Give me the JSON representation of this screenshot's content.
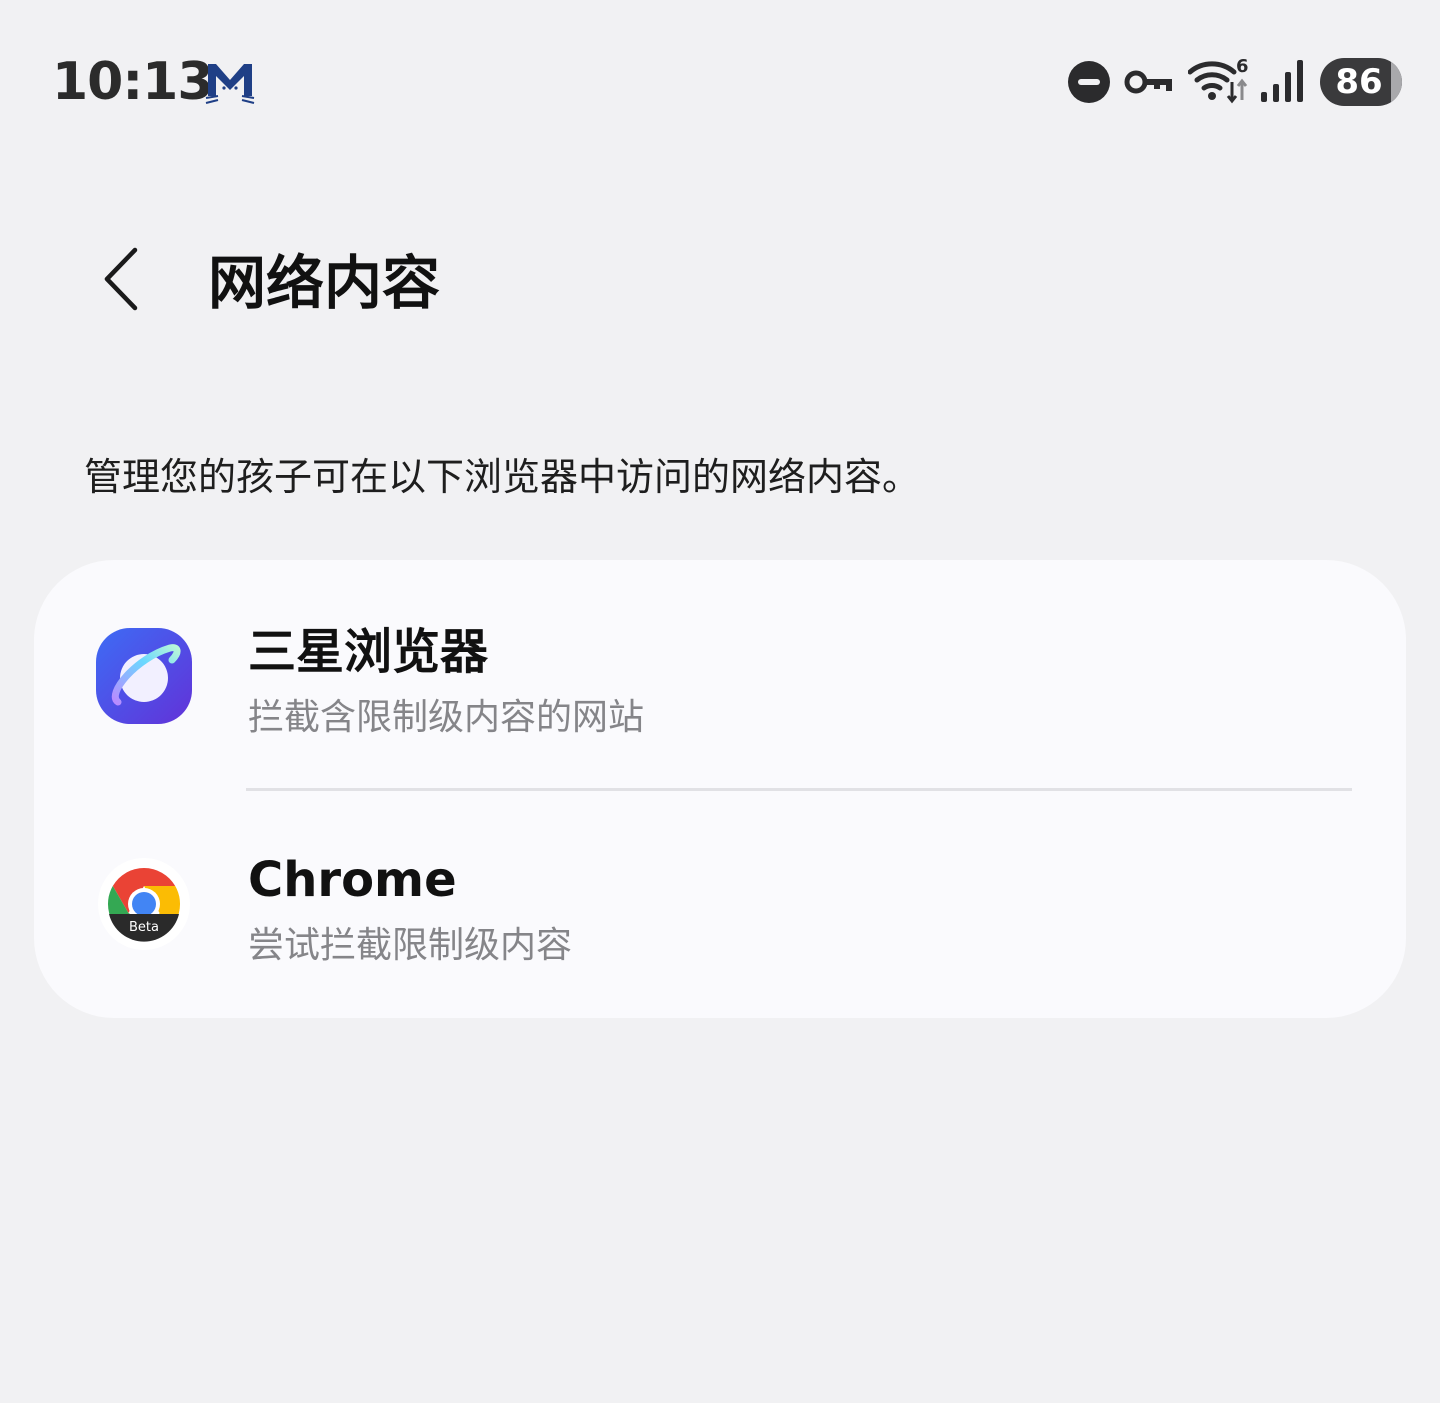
{
  "status_bar": {
    "time": "10:13",
    "battery": "86",
    "battery_level": 0.86,
    "wifi_badge": "6",
    "icons": [
      "mail-cat-icon",
      "do-not-disturb-icon",
      "vpn-key-icon",
      "wifi-icon",
      "signal-icon",
      "battery-icon"
    ]
  },
  "header": {
    "back_icon": "chevron-left-icon",
    "title": "网络内容"
  },
  "description": "管理您的孩子可在以下浏览器中访问的网络内容。",
  "browsers": [
    {
      "name": "三星浏览器",
      "status": "拦截含限制级内容的网站",
      "icon": "samsung-internet-icon"
    },
    {
      "name": "Chrome",
      "status": "尝试拦截限制级内容",
      "icon": "chrome-beta-icon",
      "icon_badge": "Beta"
    }
  ],
  "colors": {
    "background": "#f1f1f3",
    "card": "#fafafd",
    "secondary_text": "#858589",
    "samsung_blue": "#3c5ef0",
    "samsung_purple": "#6a3ee8"
  }
}
